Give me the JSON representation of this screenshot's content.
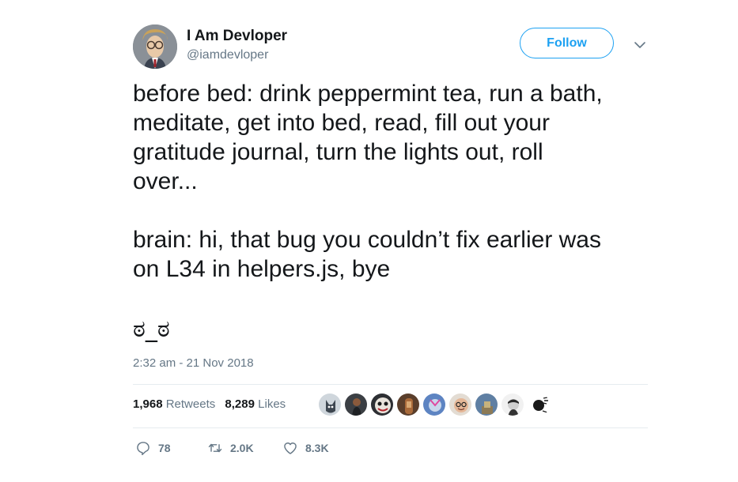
{
  "user": {
    "display_name": "I Am Devloper",
    "handle": "@iamdevloper"
  },
  "follow_label": "Follow",
  "tweet": {
    "lines_para1": [
      "before bed: drink peppermint tea, run a bath,",
      "meditate, get into bed, read, fill out your",
      "gratitude journal, turn the lights out, roll",
      "over..."
    ],
    "lines_para2": [
      "brain: hi, that bug you couldn’t fix earlier was",
      "on L34 in helpers.js, bye"
    ],
    "emoticon": "ಠ_ಠ",
    "timestamp": "2:32 am - 21 Nov 2018"
  },
  "stats": {
    "retweets_count": "1,968",
    "retweets_label": "Retweets",
    "likes_count": "8,289",
    "likes_label": "Likes"
  },
  "actions": {
    "replies": "78",
    "retweets": "2.0K",
    "likes": "8.3K"
  },
  "icons": {
    "reply": "reply-icon",
    "retweet": "retweet-icon",
    "like": "heart-icon",
    "menu": "chevron-down-icon"
  },
  "colors": {
    "accent": "#1da1f2",
    "text": "#14171a",
    "muted": "#657786",
    "divider": "#e6ecf0"
  }
}
